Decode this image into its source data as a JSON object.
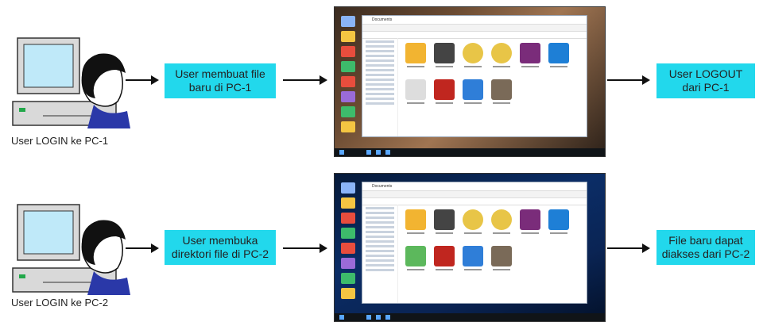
{
  "rows": [
    {
      "caption": "User LOGIN ke PC-1",
      "action_box": "User membuat file baru di PC-1",
      "result_box": "User LOGOUT dari PC-1",
      "explorer_title": "Documents"
    },
    {
      "caption": "User LOGIN ke PC-2",
      "action_box": "User membuka direktori file di PC-2",
      "result_box": "File baru dapat diakses dari PC-2",
      "explorer_title": "Documents"
    }
  ],
  "colors": {
    "box": "#22d8ec",
    "arrow": "#111111",
    "monitor_screen": "#bfe9f9",
    "desktop_pc1": "#6b4b32",
    "desktop_pc2": "#0b2d66"
  },
  "icons": [
    "computer-icon",
    "user-head-icon",
    "arrow-icon",
    "file-icon"
  ]
}
